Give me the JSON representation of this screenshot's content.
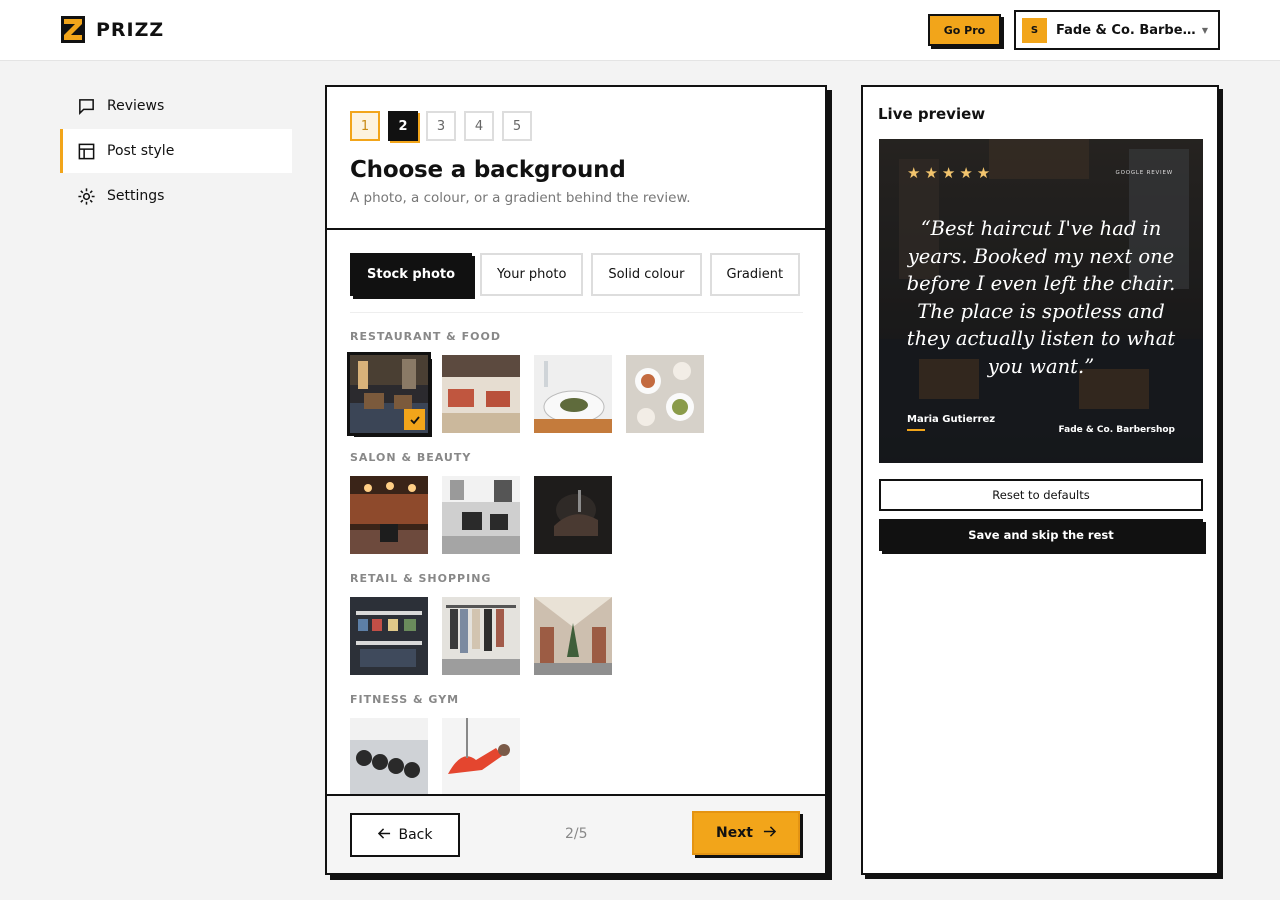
{
  "header": {
    "brand": "PRIZZ",
    "go_pro_label": "Go Pro",
    "business_avatar": "S",
    "business_name": "Fade & Co. Barbersh…"
  },
  "sidebar": {
    "items": [
      {
        "label": "Reviews",
        "icon": "chat-icon",
        "active": false
      },
      {
        "label": "Post style",
        "icon": "layout-icon",
        "active": true
      },
      {
        "label": "Settings",
        "icon": "gear-icon",
        "active": false
      }
    ]
  },
  "main": {
    "steps": [
      "1",
      "2",
      "3",
      "4",
      "5"
    ],
    "current_step": 2,
    "title": "Choose a background",
    "subtitle": "A photo, a colour, or a gradient behind the review.",
    "tabs": [
      "Stock photo",
      "Your photo",
      "Solid colour",
      "Gradient"
    ],
    "active_tab": "Stock photo",
    "categories": [
      {
        "label": "Restaurant & Food",
        "thumbs": 4
      },
      {
        "label": "Salon & Beauty",
        "thumbs": 3
      },
      {
        "label": "Retail & Shopping",
        "thumbs": 3
      },
      {
        "label": "Fitness & Gym",
        "thumbs": 2
      }
    ],
    "back_label": "Back",
    "counter": "2/5",
    "next_label": "Next"
  },
  "preview": {
    "title": "Live preview",
    "stars": "★★★★★",
    "source": "GOOGLE REVIEW",
    "quote": "“Best haircut I've had in years. Booked my next one before I even left the chair. The place is spotless and they actually listen to what you want.”",
    "author": "Maria Gutierrez",
    "business": "Fade & Co. Barbershop",
    "reset_label": "Reset to defaults",
    "save_label": "Save and skip the rest"
  },
  "colors": {
    "accent": "#f2a51a",
    "ink": "#111111",
    "background": "#f3f3f3"
  }
}
